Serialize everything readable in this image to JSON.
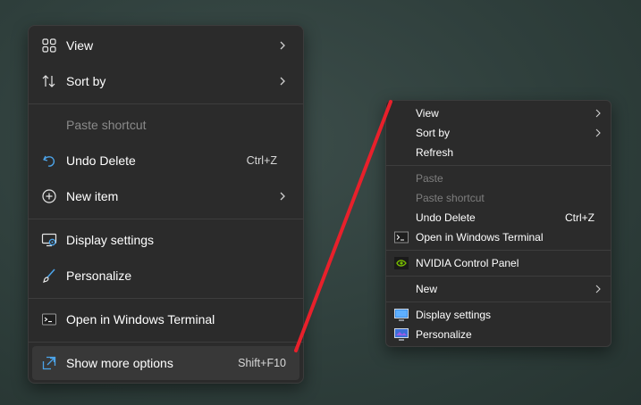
{
  "win11_menu": {
    "view": "View",
    "sort_by": "Sort by",
    "paste_shortcut": "Paste shortcut",
    "undo_delete": "Undo Delete",
    "undo_shortcut": "Ctrl+Z",
    "new_item": "New item",
    "display_settings": "Display settings",
    "personalize": "Personalize",
    "open_terminal": "Open in Windows Terminal",
    "show_more": "Show more options",
    "show_more_shortcut": "Shift+F10"
  },
  "classic_menu": {
    "view": "View",
    "sort_by": "Sort by",
    "refresh": "Refresh",
    "paste": "Paste",
    "paste_shortcut": "Paste shortcut",
    "undo_delete": "Undo Delete",
    "undo_shortcut": "Ctrl+Z",
    "open_terminal": "Open in Windows Terminal",
    "nvidia": "NVIDIA Control Panel",
    "new": "New",
    "display_settings": "Display settings",
    "personalize": "Personalize"
  },
  "colors": {
    "arrow": "#e8202b",
    "desktop": "#2f3f3c",
    "menu_bg": "#2b2b2b"
  }
}
